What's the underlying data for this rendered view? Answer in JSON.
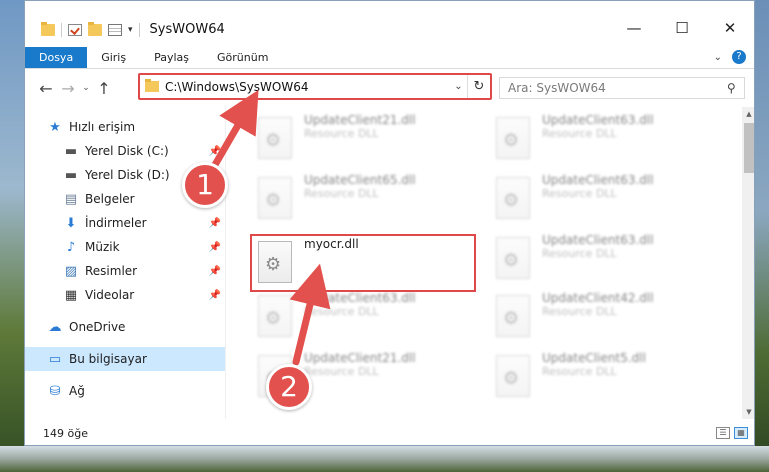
{
  "window": {
    "title": "SysWOW64",
    "controls": {
      "minimize": "—",
      "maximize": "☐",
      "close": "✕"
    }
  },
  "ribbon": {
    "tabs": [
      "Dosya",
      "Giriş",
      "Paylaş",
      "Görünüm"
    ]
  },
  "address": {
    "path": "C:\\Windows\\SysWOW64",
    "search_placeholder": "Ara: SysWOW64"
  },
  "nav": {
    "items": [
      {
        "label": "Hızlı erişim",
        "icon": "star-icon"
      },
      {
        "label": "Yerel Disk (C:)",
        "icon": "drive-icon"
      },
      {
        "label": "Yerel Disk (D:)",
        "icon": "drive-icon"
      },
      {
        "label": "Belgeler",
        "icon": "document-icon"
      },
      {
        "label": "İndirmeler",
        "icon": "download-icon"
      },
      {
        "label": "Müzik",
        "icon": "music-icon"
      },
      {
        "label": "Resimler",
        "icon": "pictures-icon"
      },
      {
        "label": "Videolar",
        "icon": "video-icon"
      },
      {
        "label": "OneDrive",
        "icon": "cloud-icon"
      },
      {
        "label": "Bu bilgisayar",
        "icon": "computer-icon"
      },
      {
        "label": "Ağ",
        "icon": "network-icon"
      }
    ]
  },
  "files": {
    "left": [
      {
        "name": "UpdateClient21.dll",
        "type": "Resource DLL"
      },
      {
        "name": "UpdateClient65.dll",
        "type": "Resource DLL"
      },
      {
        "name": "myocr.dll",
        "type": ""
      },
      {
        "name": "UpdateClient63.dll",
        "type": "Resource DLL"
      },
      {
        "name": "UpdateClient21.dll",
        "type": "Resource DLL"
      }
    ],
    "right": [
      {
        "name": "UpdateClient63.dll",
        "type": "Resource DLL"
      },
      {
        "name": "UpdateClient63.dll",
        "type": "Resource DLL"
      },
      {
        "name": "UpdateClient63.dll",
        "type": "Resource DLL"
      },
      {
        "name": "UpdateClient42.dll",
        "type": "Resource DLL"
      },
      {
        "name": "UpdateClient5.dll",
        "type": "Resource DLL"
      }
    ]
  },
  "status": {
    "count": "149 öğe"
  },
  "annotations": {
    "badge1": "1",
    "badge2": "2",
    "color": "#e2514d"
  }
}
